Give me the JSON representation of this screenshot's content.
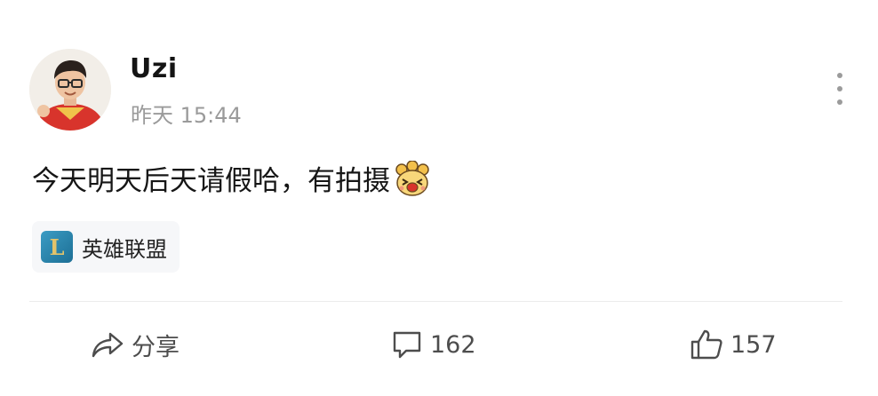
{
  "post": {
    "username": "Uzi",
    "timestamp": "昨天 15:44",
    "text": "今天明天后天请假哈，有拍摄",
    "emoji_icon": "laughing-face-emoji-icon",
    "topic": {
      "label": "英雄联盟",
      "logo_letter": "L",
      "logo_icon": "league-of-legends-logo-icon"
    }
  },
  "actions": {
    "share_label": "分享",
    "comment_count": "162",
    "like_count": "157"
  },
  "colors": {
    "text": "#161616",
    "secondary_text": "#9a9a9a",
    "action_text": "#4d4d4d",
    "chip_background": "#f6f7f9",
    "divider": "#ececec"
  }
}
